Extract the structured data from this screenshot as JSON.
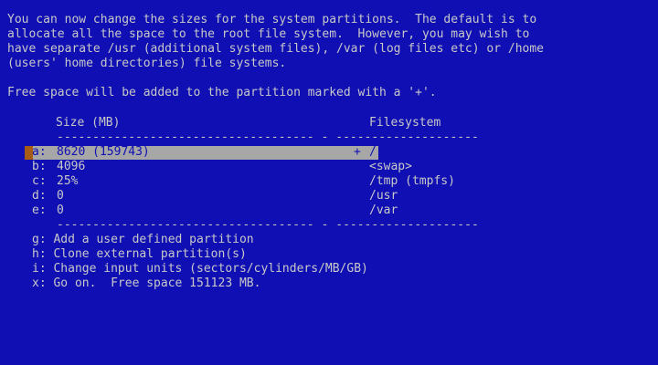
{
  "intro": {
    "line1": "You can now change the sizes for the system partitions.  The default is to",
    "line2": "allocate all the space to the root file system.  However, you may wish to",
    "line3": "have separate /usr (additional system files), /var (log files etc) or /home",
    "line4": "(users' home directories) file systems.",
    "free_space_note": "Free space will be added to the partition marked with a '+'."
  },
  "table": {
    "header_size": "Size (MB)",
    "header_fs": "Filesystem",
    "separator": "------------------------------------ - --------------------",
    "rows": [
      {
        "key": "a:",
        "size": "8620 (159743)",
        "flag": "+",
        "fs": "/"
      },
      {
        "key": "b:",
        "size": "4096",
        "flag": "",
        "fs": "<swap>"
      },
      {
        "key": "c:",
        "size": "25%",
        "flag": "",
        "fs": "/tmp (tmpfs)"
      },
      {
        "key": "d:",
        "size": "0",
        "flag": "",
        "fs": "/usr"
      },
      {
        "key": "e:",
        "size": "0",
        "flag": "",
        "fs": "/var"
      }
    ]
  },
  "menu": {
    "g": "g: Add a user defined partition",
    "h": "h: Clone external partition(s)",
    "i": "i: Change input units (sectors/cylinders/MB/GB)",
    "x": "x: Go on.  Free space 151123 MB."
  },
  "cursor_icon": "arrow-right-icon",
  "colors": {
    "background": "#0f0fb4",
    "text": "#c8c8c8",
    "highlight": "#a7a7a7",
    "cursor": "#a65b16"
  }
}
